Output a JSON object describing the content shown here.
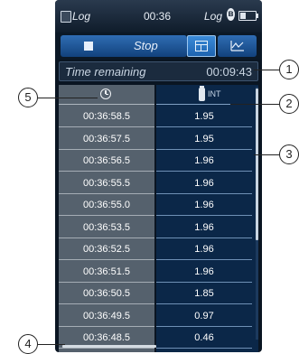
{
  "statusbar": {
    "app_name": "Log",
    "clock": "00:36",
    "mode_label": "Log",
    "bluetooth_glyph": "ʙ"
  },
  "toolbar": {
    "stop_label": "Stop",
    "active_view": "table",
    "icons": [
      "stop-square-icon",
      "table-grid-icon",
      "line-chart-icon"
    ]
  },
  "remaining": {
    "label": "Time remaining",
    "value": "00:09:43"
  },
  "table": {
    "value_unit": "INT",
    "rows": [
      {
        "time": "00:36:58.5",
        "value": "1.95"
      },
      {
        "time": "00:36:57.5",
        "value": "1.95"
      },
      {
        "time": "00:36:56.5",
        "value": "1.96"
      },
      {
        "time": "00:36:55.5",
        "value": "1.96"
      },
      {
        "time": "00:36:55.0",
        "value": "1.96"
      },
      {
        "time": "00:36:53.5",
        "value": "1.96"
      },
      {
        "time": "00:36:52.5",
        "value": "1.96"
      },
      {
        "time": "00:36:51.5",
        "value": "1.96"
      },
      {
        "time": "00:36:50.5",
        "value": "1.85"
      },
      {
        "time": "00:36:49.5",
        "value": "0.97"
      },
      {
        "time": "00:36:48.5",
        "value": "0.46"
      }
    ]
  },
  "callouts": [
    "1",
    "2",
    "3",
    "4",
    "5"
  ],
  "colors": {
    "accent_blue": "#1e63b0",
    "value_column_bg": "#0b2748",
    "time_column_bg": "#55616d"
  }
}
